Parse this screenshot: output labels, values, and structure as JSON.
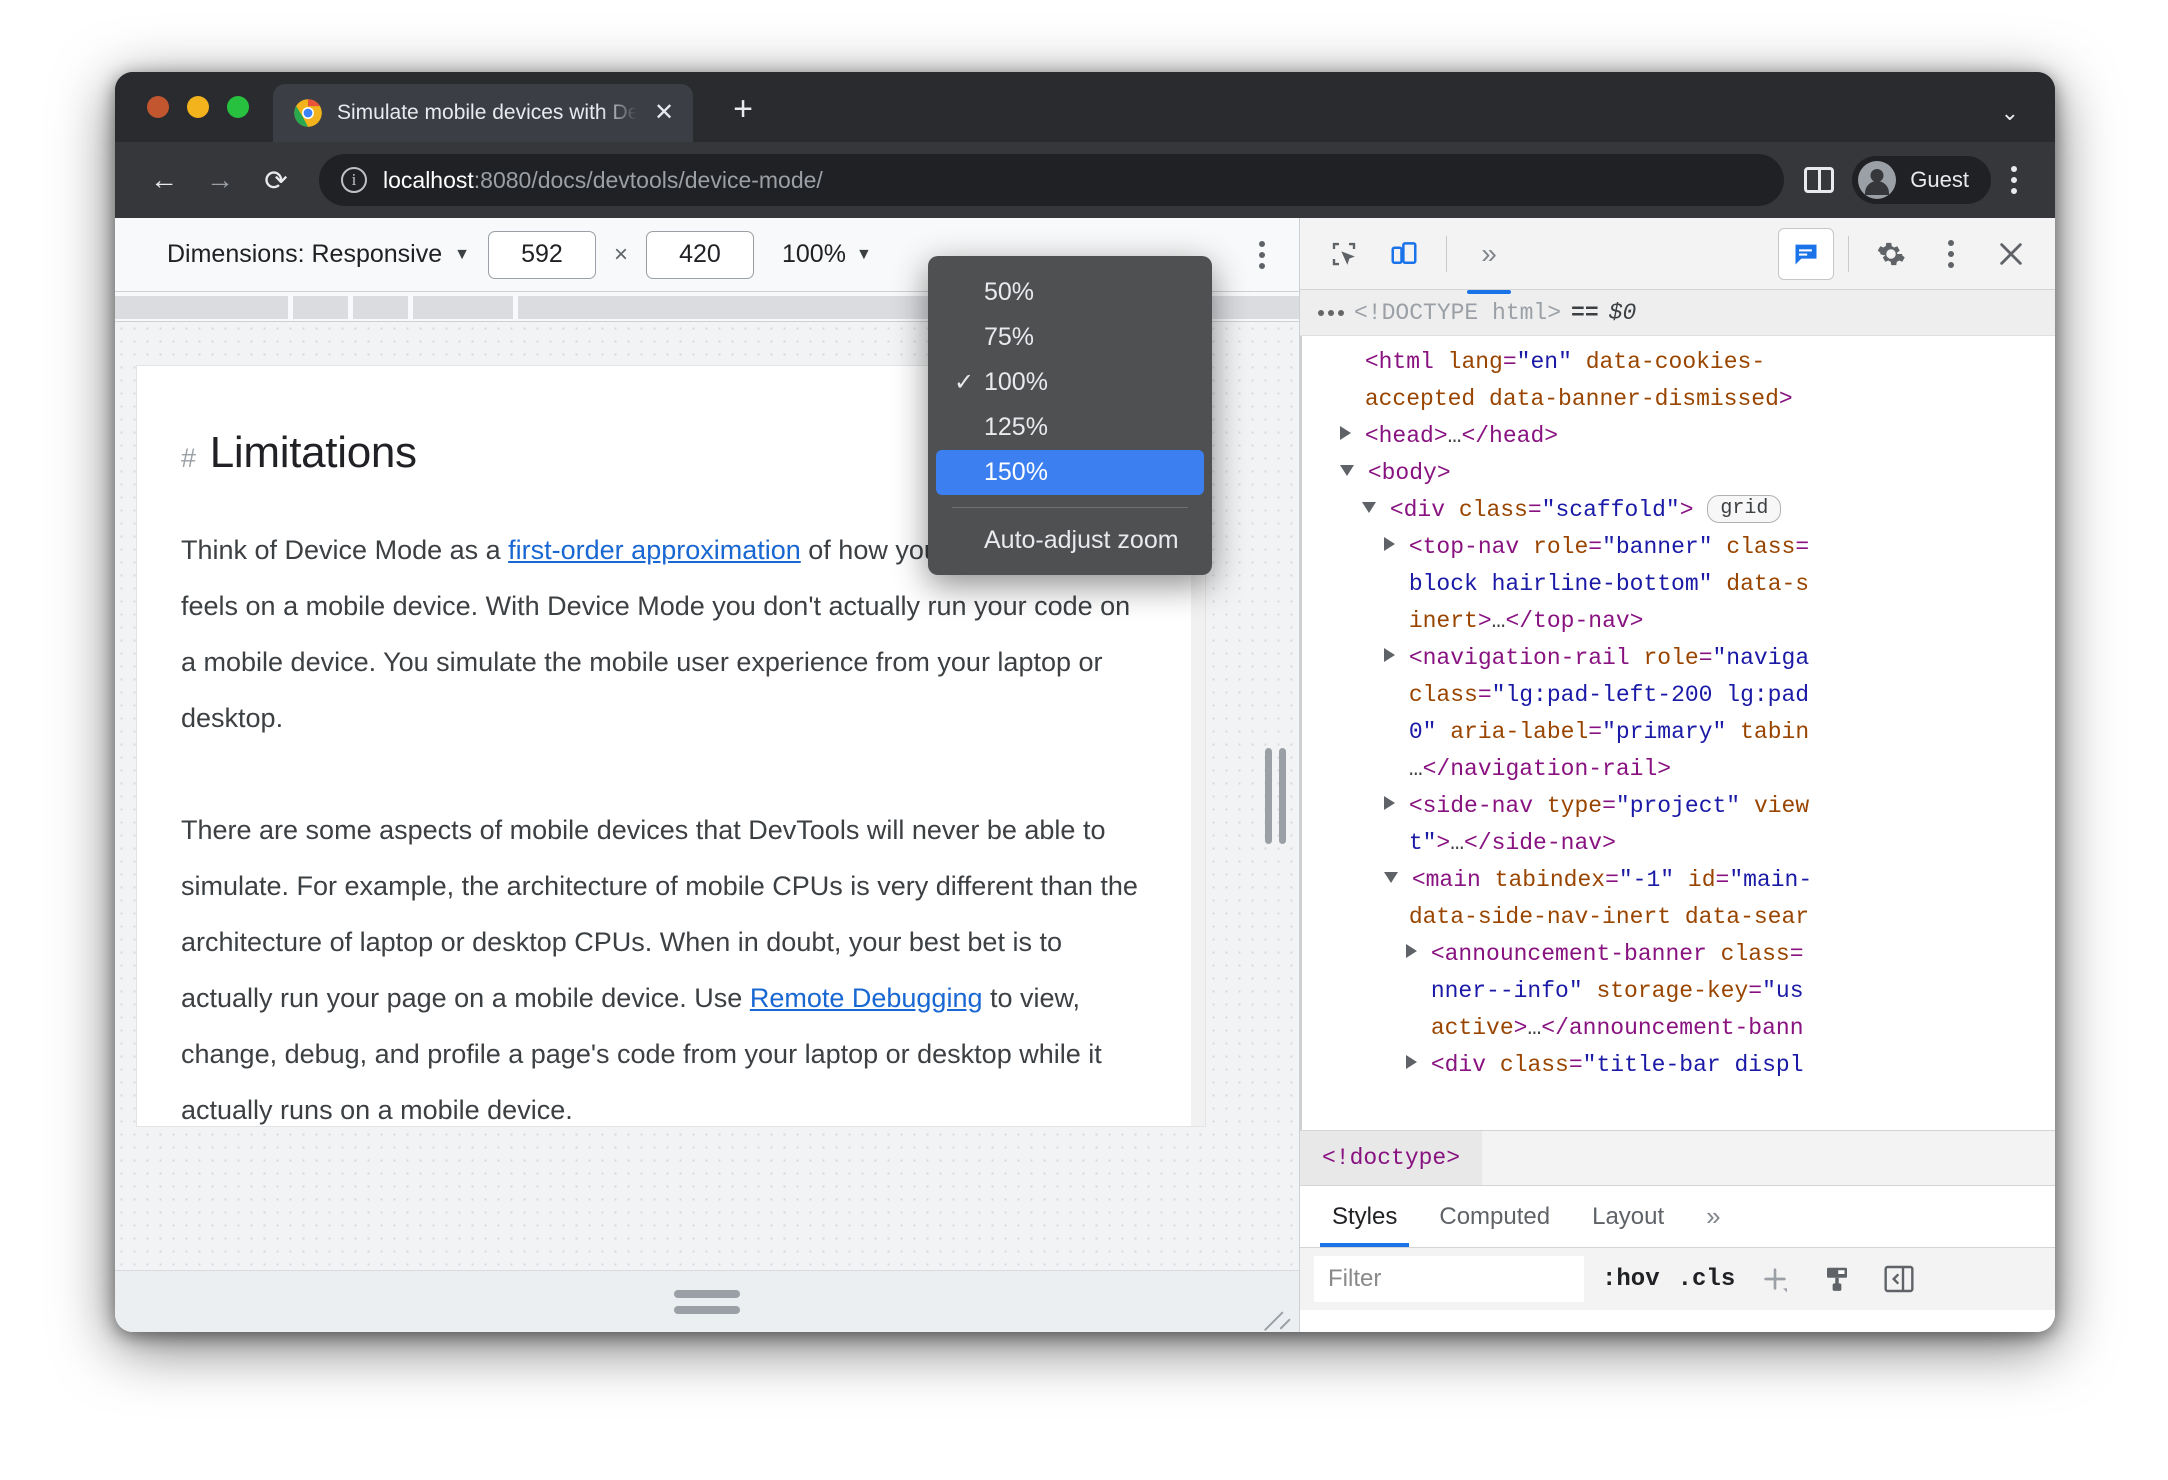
{
  "browser": {
    "tab": {
      "title": "Simulate mobile devices with DevTools",
      "close_label": "✕",
      "favicon": "chrome-icon"
    },
    "new_tab_label": "+",
    "tabstrip_chevron": "⌄",
    "nav": {
      "back": "←",
      "forward": "→",
      "reload": "⟳"
    },
    "omnibox": {
      "info_icon": "i",
      "host": "localhost",
      "path": ":8080/docs/devtools/device-mode/"
    },
    "side_panel_icon": "side-panel-icon",
    "profile": {
      "name": "Guest",
      "avatar": "account-circle-icon"
    },
    "menu_icon": "kebab-menu-icon"
  },
  "device_toolbar": {
    "dimensions_label": "Dimensions: Responsive",
    "dimensions_caret": "▼",
    "width": "592",
    "separator": "×",
    "height": "420",
    "zoom_label": "100%",
    "zoom_caret": "▼",
    "more_options_icon": "kebab-menu-icon"
  },
  "zoom_menu": {
    "items": [
      {
        "label": "50%",
        "checked": false,
        "selected": false
      },
      {
        "label": "75%",
        "checked": false,
        "selected": false
      },
      {
        "label": "100%",
        "checked": true,
        "selected": false
      },
      {
        "label": "125%",
        "checked": false,
        "selected": false
      },
      {
        "label": "150%",
        "checked": false,
        "selected": true
      }
    ],
    "check_glyph": "✓",
    "footer_item": "Auto-adjust zoom"
  },
  "page": {
    "heading_hash": "#",
    "heading": "Limitations",
    "paragraph1": {
      "before_link": "Think of Device Mode as a ",
      "link": "first-order approximation",
      "after_link": " of how your page looks and feels on a mobile device. With Device Mode you don't actually run your code on a mobile device. You simulate the mobile user experience from your laptop or desktop."
    },
    "paragraph2": {
      "before_link": "There are some aspects of mobile devices that DevTools will never be able to simulate. For example, the architecture of mobile CPUs is very different than the architecture of laptop or desktop CPUs. When in doubt, your best bet is to actually run your page on a mobile device. Use ",
      "link": "Remote Debugging",
      "after_link": " to view, change, debug, and profile a page's code from your laptop or desktop while it actually runs on a mobile device."
    }
  },
  "devtools": {
    "toolbar": {
      "inspect_icon": "inspect-element-icon",
      "device_toggle_icon": "device-toolbar-icon",
      "more_panels_icon": "chevron-double-right-icon",
      "feedback_icon": "feedback-icon",
      "settings_icon": "gear-icon",
      "more_icon": "kebab-menu-icon",
      "close_icon": "close-icon"
    },
    "doctype_row": {
      "doctype": "<!DOCTYPE html>",
      "equals": "==",
      "dollar": "$0"
    },
    "dom_lines": [
      {
        "indent": 1,
        "tri": "none",
        "html": "<span class=\"tok-tag\">&lt;html</span> <span class=\"tok-attr\">lang</span><span class=\"tok-tag\">=</span><span class=\"tok-val\">\"en\"</span> <span class=\"tok-attr\">data-cookies-</span>"
      },
      {
        "indent": 1,
        "tri": "none",
        "html": "<span class=\"tok-attr\">accepted data-banner-dismissed</span><span class=\"tok-tag\">&gt;</span>"
      },
      {
        "indent": 1,
        "tri": "closed",
        "html": "<span class=\"tok-tag\">&lt;head&gt;</span><span class=\"tok-txt\">…</span><span class=\"tok-tag\">&lt;/head&gt;</span>"
      },
      {
        "indent": 1,
        "tri": "open",
        "html": "<span class=\"tok-tag\">&lt;body&gt;</span>"
      },
      {
        "indent": 2,
        "tri": "open",
        "html": "<span class=\"tok-tag\">&lt;div</span> <span class=\"tok-attr\">class</span><span class=\"tok-tag\">=</span><span class=\"tok-val\">\"scaffold\"</span><span class=\"tok-tag\">&gt;</span> <span class=\"badge-grid\">grid</span>"
      },
      {
        "indent": 3,
        "tri": "closed",
        "html": "<span class=\"tok-tag\">&lt;top-nav</span> <span class=\"tok-attr\">role</span><span class=\"tok-tag\">=</span><span class=\"tok-val\">\"banner\"</span> <span class=\"tok-attr\">class</span><span class=\"tok-tag\">=</span>"
      },
      {
        "indent": 3,
        "tri": "none",
        "html": "<span class=\"tok-val\">block hairline-bottom\"</span> <span class=\"tok-attr\">data-s</span>"
      },
      {
        "indent": 3,
        "tri": "none",
        "html": "<span class=\"tok-attr\">inert</span><span class=\"tok-tag\">&gt;</span><span class=\"tok-txt\">…</span><span class=\"tok-tag\">&lt;/top-nav&gt;</span>"
      },
      {
        "indent": 3,
        "tri": "closed",
        "html": "<span class=\"tok-tag\">&lt;navigation-rail</span> <span class=\"tok-attr\">role</span><span class=\"tok-tag\">=</span><span class=\"tok-val\">\"naviga</span>"
      },
      {
        "indent": 3,
        "tri": "none",
        "html": "<span class=\"tok-attr\">class</span><span class=\"tok-tag\">=</span><span class=\"tok-val\">\"lg:pad-left-200 lg:pad</span>"
      },
      {
        "indent": 3,
        "tri": "none",
        "html": "<span class=\"tok-val\">0\"</span> <span class=\"tok-attr\">aria-label</span><span class=\"tok-tag\">=</span><span class=\"tok-val\">\"primary\"</span> <span class=\"tok-attr\">tabin</span>"
      },
      {
        "indent": 3,
        "tri": "none",
        "html": "<span class=\"tok-txt\">…</span><span class=\"tok-tag\">&lt;/navigation-rail&gt;</span>"
      },
      {
        "indent": 3,
        "tri": "closed",
        "html": "<span class=\"tok-tag\">&lt;side-nav</span> <span class=\"tok-attr\">type</span><span class=\"tok-tag\">=</span><span class=\"tok-val\">\"project\"</span> <span class=\"tok-attr\">view</span>"
      },
      {
        "indent": 3,
        "tri": "none",
        "html": "<span class=\"tok-val\">t\"</span><span class=\"tok-tag\">&gt;</span><span class=\"tok-txt\">…</span><span class=\"tok-tag\">&lt;/side-nav&gt;</span>"
      },
      {
        "indent": 3,
        "tri": "open",
        "html": "<span class=\"tok-tag\">&lt;main</span> <span class=\"tok-attr\">tabindex</span><span class=\"tok-tag\">=</span><span class=\"tok-val\">\"-1\"</span> <span class=\"tok-attr\">id</span><span class=\"tok-tag\">=</span><span class=\"tok-val\">\"main-</span>"
      },
      {
        "indent": 3,
        "tri": "none",
        "html": "<span class=\"tok-attr\">data-side-nav-inert data-sear</span>"
      },
      {
        "indent": 4,
        "tri": "closed",
        "html": "<span class=\"tok-tag\">&lt;announcement-banner</span> <span class=\"tok-attr\">class</span><span class=\"tok-tag\">=</span>"
      },
      {
        "indent": 4,
        "tri": "none",
        "html": "<span class=\"tok-val\">nner--info\"</span> <span class=\"tok-attr\">storage-key</span><span class=\"tok-tag\">=</span><span class=\"tok-val\">\"us</span>"
      },
      {
        "indent": 4,
        "tri": "none",
        "html": "<span class=\"tok-attr\">active</span><span class=\"tok-tag\">&gt;</span><span class=\"tok-txt\">…</span><span class=\"tok-tag\">&lt;/announcement-bann</span>"
      },
      {
        "indent": 4,
        "tri": "closed",
        "html": "<span class=\"tok-tag\">&lt;div</span> <span class=\"tok-attr\">class</span><span class=\"tok-tag\">=</span><span class=\"tok-val\">\"title-bar displ</span>"
      }
    ],
    "breadcrumb": "<!doctype>",
    "tabs": [
      {
        "label": "Styles",
        "active": true
      },
      {
        "label": "Computed",
        "active": false
      },
      {
        "label": "Layout",
        "active": false
      },
      {
        "label": "»",
        "active": false
      }
    ],
    "filter": {
      "placeholder": "Filter",
      "hov": ":hov",
      "cls": ".cls",
      "add_icon": "plus-icon",
      "new_style_icon": "paint-bucket-icon",
      "toggle_sidebar_icon": "toggle-sidebar-icon"
    }
  },
  "colors": {
    "accent": "#1a73e8",
    "menu_selected": "#3b7ff0",
    "link": "#1967d2",
    "chrome_dark": "#292b2f"
  }
}
